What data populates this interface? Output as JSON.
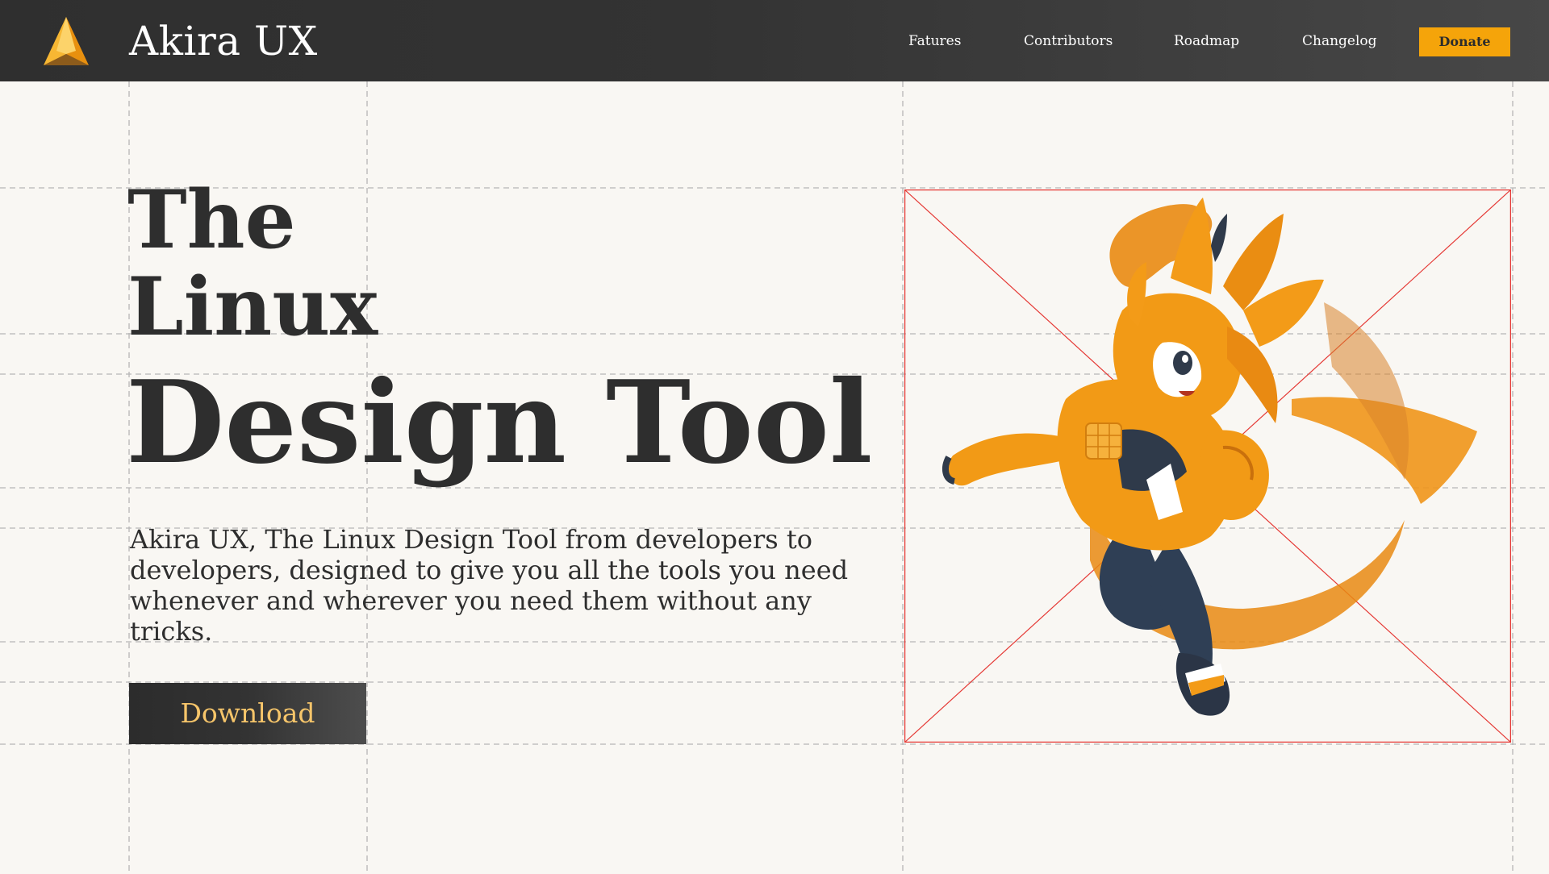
{
  "header": {
    "brand": "Akira UX",
    "logo_icon": "akira-logo-icon",
    "nav": [
      {
        "label": "Fatures"
      },
      {
        "label": "Contributors"
      },
      {
        "label": "Roadmap"
      },
      {
        "label": "Changelog"
      }
    ],
    "donate_label": "Donate"
  },
  "hero": {
    "headline_line1": "The",
    "headline_line2": "Linux",
    "headline_line3": "Design Tool",
    "description": "Akira UX, The Linux Design Tool from developers to developers, designed to give you all the tools you need whenever and wherever you need them without any tricks.",
    "download_label": "Download",
    "illustration_icon": "mascot-illustration"
  },
  "colors": {
    "header_bg": "#333333",
    "page_bg": "#f9f7f3",
    "accent": "#f5a40a",
    "text": "#2e2e2e",
    "download_text": "#f6c56a",
    "guide_box": "#e53935"
  }
}
